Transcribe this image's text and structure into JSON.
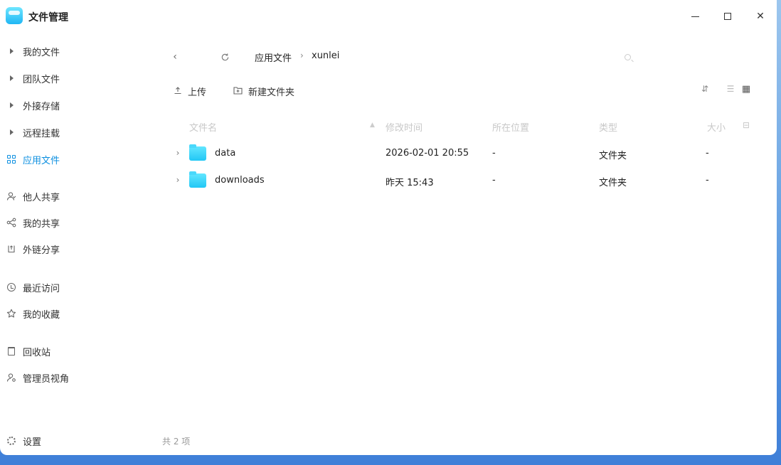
{
  "app": {
    "title": "文件管理"
  },
  "window_controls": {
    "minimize_icon": "minimize-icon",
    "maximize_icon": "maximize-icon",
    "close_label": "✕"
  },
  "sidebar": {
    "groups": [
      {
        "label": "我的文件",
        "icon": "triangle-right-icon"
      },
      {
        "label": "团队文件",
        "icon": "triangle-right-icon"
      },
      {
        "label": "外接存储",
        "icon": "triangle-right-icon"
      },
      {
        "label": "远程挂载",
        "icon": "triangle-right-icon"
      },
      {
        "label": "应用文件",
        "icon": "grid-icon",
        "active": true
      }
    ],
    "share": [
      {
        "label": "他人共享",
        "icon": "users-icon"
      },
      {
        "label": "我的共享",
        "icon": "share-icon"
      },
      {
        "label": "外链分享",
        "icon": "link-share-icon"
      }
    ],
    "recent": [
      {
        "label": "最近访问",
        "icon": "clock-icon"
      },
      {
        "label": "我的收藏",
        "icon": "star-icon"
      }
    ],
    "system": [
      {
        "label": "回收站",
        "icon": "trash-icon"
      },
      {
        "label": "管理员视角",
        "icon": "admin-icon"
      }
    ],
    "settings_label": "设置"
  },
  "navigation": {
    "breadcrumb": [
      "应用文件",
      "xunlei"
    ],
    "separator": "›"
  },
  "toolbar": {
    "upload_label": "上传",
    "new_folder_label": "新建文件夹"
  },
  "table": {
    "headers": {
      "name": "文件名",
      "mtime": "修改时间",
      "location": "所在位置",
      "type": "类型",
      "size": "大小"
    },
    "rows": [
      {
        "name": "data",
        "mtime": "2026-02-01 20:55",
        "location": "-",
        "type": "文件夹",
        "size": "-"
      },
      {
        "name": "downloads",
        "mtime": "昨天 15:43",
        "location": "-",
        "type": "文件夹",
        "size": "-"
      }
    ]
  },
  "footer": {
    "count_text": "共 2 项"
  },
  "colors": {
    "accent": "#0c8fe0",
    "folder": "#21c7f5",
    "desktop": "#5c9ae0"
  }
}
